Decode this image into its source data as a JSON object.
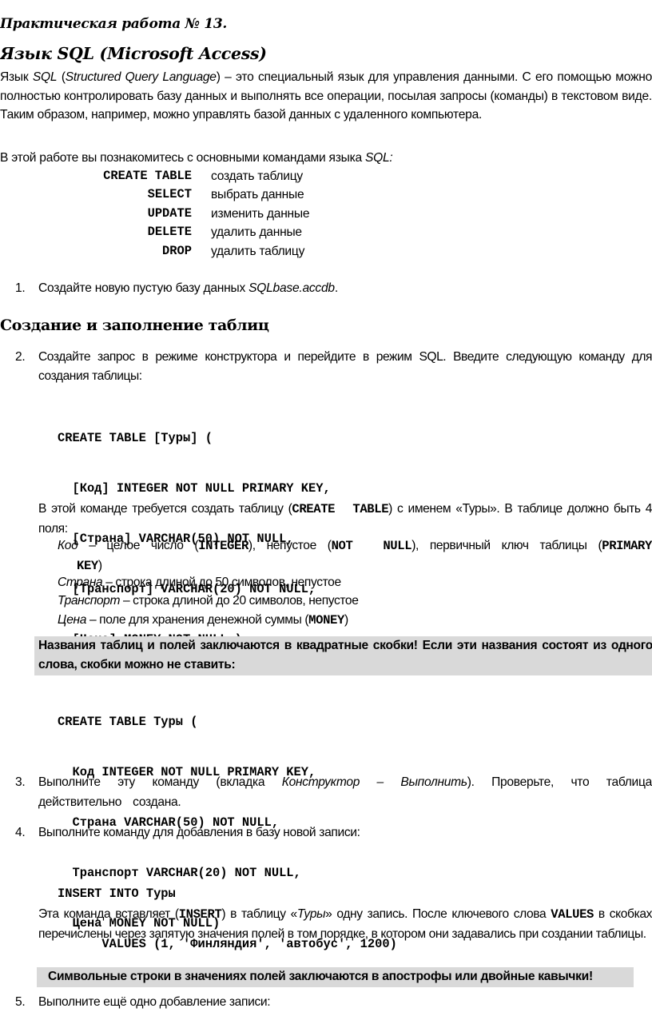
{
  "title": "Практическая работа № 13.",
  "subtitle": "Язык SQL (Microsoft Access)",
  "intro": {
    "p1_a": "Язык ",
    "p1_sql": "SQL",
    "p1_b": " (",
    "p1_full": "Structured Query Language",
    "p1_c": ") – это специальный язык для управления данными. С его помощью можно полностью контролировать базу данных и выполнять все операции, посылая запросы (команды) в текстовом виде. Таким образом, например, можно управлять базой данных с удаленного компьютера.",
    "p2_a": "В этой работе вы познакомитесь с основными командами языка ",
    "p2_sql": "SQL:"
  },
  "commands": [
    {
      "keyword": "CREATE TABLE",
      "description": "создать таблицу"
    },
    {
      "keyword": "SELECT",
      "description": "выбрать данные"
    },
    {
      "keyword": "UPDATE",
      "description": "изменить данные"
    },
    {
      "keyword": "DELETE",
      "description": "удалить данные"
    },
    {
      "keyword": "DROP",
      "description": "удалить таблицу"
    }
  ],
  "step1": {
    "num": "1.",
    "text_a": "Создайте новую пустую базу данных ",
    "filename": "SQLbase.accdb",
    "text_b": "."
  },
  "section_heading": "Создание и заполнение таблиц",
  "step2": {
    "num": "2.",
    "text": "Создайте запрос в режиме конструктора и перейдите в режим SQL. Введите следующую команду для создания таблицы:",
    "code": [
      "CREATE TABLE [Туры] (",
      "  [Код] INTEGER NOT NULL PRIMARY KEY,",
      "  [Страна] VARCHAR(50) NOT NULL,",
      "  [Транспорт] VARCHAR(20) NOT NULL,",
      "  [Цена] MONEY NOT NULL )"
    ],
    "explain_a": "В этой команде требуется создать таблицу (",
    "explain_kw": "CREATE  TABLE",
    "explain_b": ") с именем «Туры». В  таблице должно быть 4 поля:",
    "fields": [
      {
        "name": "Код",
        "desc_a": " – целое число (",
        "kw1": "INTEGER",
        "desc_b": "), непустое (",
        "kw2": "NOT  NULL",
        "desc_c": "), первичный ключ таблицы (",
        "kw3a": "PRIMARY",
        "kw3b": "KEY",
        "desc_d": ")"
      },
      {
        "name": "Страна",
        "desc": " – строка длиной до 50 символов, непустое"
      },
      {
        "name": "Транспорт",
        "desc": " – строка длиной до 20 символов, непустое"
      },
      {
        "name": "Цена",
        "desc_a": " – поле для хранения денежной суммы (",
        "kw": "MONEY",
        "desc_b": ")"
      }
    ],
    "note": "Названия таблиц и полей заключаются в квадратные скобки! Если эти названия состоят из одного слова, скобки можно не ставить:",
    "code2": [
      "CREATE TABLE Туры (",
      "  Код INTEGER NOT NULL PRIMARY KEY,",
      "  Страна VARCHAR(50) NOT NULL,",
      "  Транспорт VARCHAR(20) NOT NULL,",
      "  Цена MONEY NOT NULL)"
    ]
  },
  "step3": {
    "num": "3.",
    "text_a": "Выполните эту команду (вкладка ",
    "menu_path": "Конструктор – Выполнить",
    "text_b": "). Проверьте, что таблица действительно создана."
  },
  "step4": {
    "num": "4.",
    "text": "Выполните команду для добавления в базу новой записи:",
    "code": [
      "INSERT INTO Туры",
      "      VALUES (1, 'Финляндия', 'автобус', 1200)"
    ],
    "explain_a": "Эта команда вставляет (",
    "explain_kw": "INSERT",
    "explain_b": ") в таблицу «",
    "explain_table": "Туры",
    "explain_c": "» одну запись. После ключевого слова ",
    "explain_kw2": "VALUES",
    "explain_d": " в скобках перечислены через запятую значения полей в том порядке, в котором они задавались при создании таблицы.",
    "note": "Символьные строки в значениях полей заключаются в апострофы или двойные кавычки!"
  },
  "step5": {
    "num": "5.",
    "text": "Выполните ещё одно добавление записи:"
  }
}
